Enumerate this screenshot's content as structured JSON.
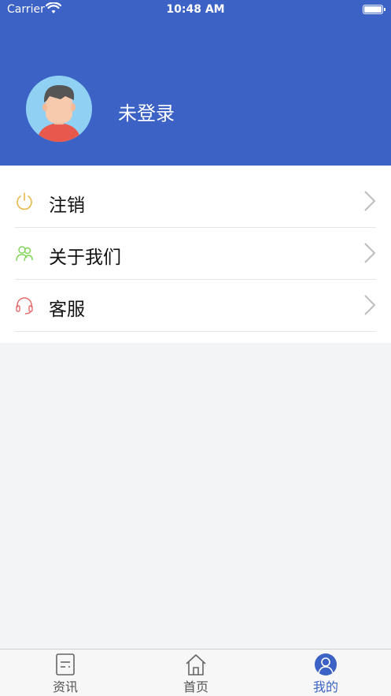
{
  "status_bar": {
    "carrier": "Carrier",
    "time": "10:48 AM"
  },
  "profile": {
    "login_status": "未登录",
    "avatar_icon": "user-avatar-icon"
  },
  "menu": {
    "items": [
      {
        "label": "注销",
        "icon": "power-icon",
        "color": "#e6b84a"
      },
      {
        "label": "关于我们",
        "icon": "people-icon",
        "color": "#7fd35a"
      },
      {
        "label": "客服",
        "icon": "headset-icon",
        "color": "#e46a6a"
      }
    ]
  },
  "tabbar": {
    "tabs": [
      {
        "label": "资讯",
        "icon": "news-icon",
        "active": false
      },
      {
        "label": "首页",
        "icon": "home-icon",
        "active": false
      },
      {
        "label": "我的",
        "icon": "profile-icon",
        "active": true
      }
    ]
  },
  "colors": {
    "brand_blue": "#3b62c4",
    "background": "#f3f4f6"
  }
}
